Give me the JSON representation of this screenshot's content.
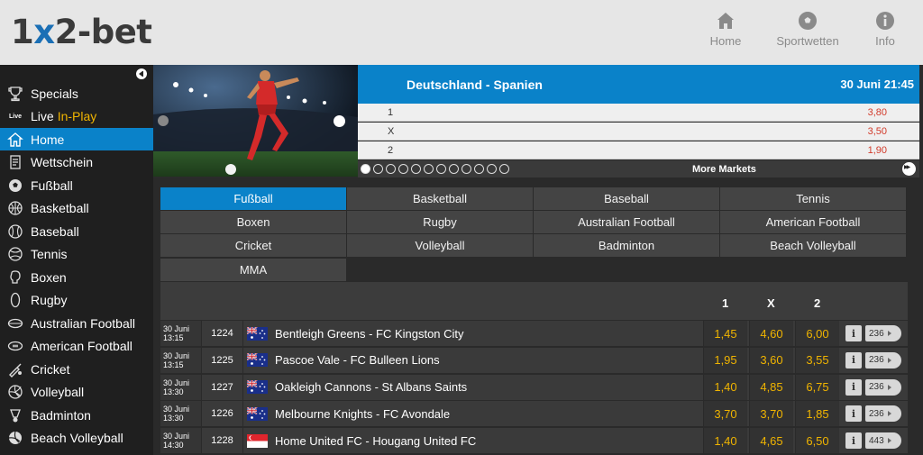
{
  "header": {
    "logo_pre": "1",
    "logo_x": "x",
    "logo_post": "2-bet",
    "nav": [
      {
        "label": "Home",
        "icon": "house-icon"
      },
      {
        "label": "Sportwetten",
        "icon": "soccer-ball-icon"
      },
      {
        "label": "Info",
        "icon": "info-icon"
      }
    ]
  },
  "sidebar": {
    "items": [
      {
        "label": "Specials",
        "icon": "trophy-icon"
      },
      {
        "label": "Live",
        "label2": "In-Play",
        "icon": "live-icon",
        "icon_text": "Live"
      },
      {
        "label": "Home",
        "icon": "house-icon",
        "active": true
      },
      {
        "label": "Wettschein",
        "icon": "betslip-icon"
      },
      {
        "label": "Fußball",
        "icon": "soccer-ball-icon"
      },
      {
        "label": "Basketball",
        "icon": "basketball-icon"
      },
      {
        "label": "Baseball",
        "icon": "baseball-icon"
      },
      {
        "label": "Tennis",
        "icon": "tennis-ball-icon"
      },
      {
        "label": "Boxen",
        "icon": "boxing-glove-icon"
      },
      {
        "label": "Rugby",
        "icon": "rugby-ball-icon"
      },
      {
        "label": "Australian Football",
        "icon": "australian-football-icon"
      },
      {
        "label": "American Football",
        "icon": "american-football-icon"
      },
      {
        "label": "Cricket",
        "icon": "cricket-bat-icon"
      },
      {
        "label": "Volleyball",
        "icon": "volleyball-icon"
      },
      {
        "label": "Badminton",
        "icon": "shuttlecock-icon"
      },
      {
        "label": "Beach Volleyball",
        "icon": "beach-volleyball-icon"
      }
    ]
  },
  "featured": {
    "title": "Deutschland - Spanien",
    "date": "30 Juni 21:45",
    "odds": [
      {
        "label": "1",
        "value": "3,80"
      },
      {
        "label": "X",
        "value": "3,50"
      },
      {
        "label": "2",
        "value": "1,90"
      }
    ],
    "more_markets": "More Markets",
    "dots_total": 12,
    "dots_active": 0
  },
  "sports": [
    {
      "label": "Fußball",
      "active": true
    },
    {
      "label": "Basketball"
    },
    {
      "label": "Baseball"
    },
    {
      "label": "Tennis"
    },
    {
      "label": "Boxen"
    },
    {
      "label": "Rugby"
    },
    {
      "label": "Australian Football"
    },
    {
      "label": "American Football"
    },
    {
      "label": "Cricket"
    },
    {
      "label": "Volleyball"
    },
    {
      "label": "Badminton"
    },
    {
      "label": "Beach Volleyball"
    },
    {
      "label": "MMA"
    }
  ],
  "table": {
    "headers": [
      "1",
      "X",
      "2"
    ],
    "rows": [
      {
        "date": "30 Juni",
        "time": "13:15",
        "id": "1224",
        "flag": "australia",
        "match": "Bentleigh Greens - FC Kingston City",
        "odds": [
          "1,45",
          "4,60",
          "6,00"
        ],
        "markets": "236"
      },
      {
        "date": "30 Juni",
        "time": "13:15",
        "id": "1225",
        "flag": "australia",
        "match": "Pascoe Vale - FC Bulleen Lions",
        "odds": [
          "1,95",
          "3,60",
          "3,55"
        ],
        "markets": "236"
      },
      {
        "date": "30 Juni",
        "time": "13:30",
        "id": "1227",
        "flag": "australia",
        "match": "Oakleigh Cannons - St Albans Saints",
        "odds": [
          "1,40",
          "4,85",
          "6,75"
        ],
        "markets": "236"
      },
      {
        "date": "30 Juni",
        "time": "13:30",
        "id": "1226",
        "flag": "australia",
        "match": "Melbourne Knights - FC Avondale",
        "odds": [
          "3,70",
          "3,70",
          "1,85"
        ],
        "markets": "236"
      },
      {
        "date": "30 Juni",
        "time": "14:30",
        "id": "1228",
        "flag": "singapore",
        "match": "Home United FC - Hougang United FC",
        "odds": [
          "1,40",
          "4,65",
          "6,50"
        ],
        "markets": "443"
      }
    ]
  },
  "colors": {
    "accent": "#0a82c9",
    "odds": "#f0b400",
    "odds_featured": "#d23a2a",
    "header_bg": "#e6e6e6",
    "sidebar_bg": "#1f1f1f"
  }
}
